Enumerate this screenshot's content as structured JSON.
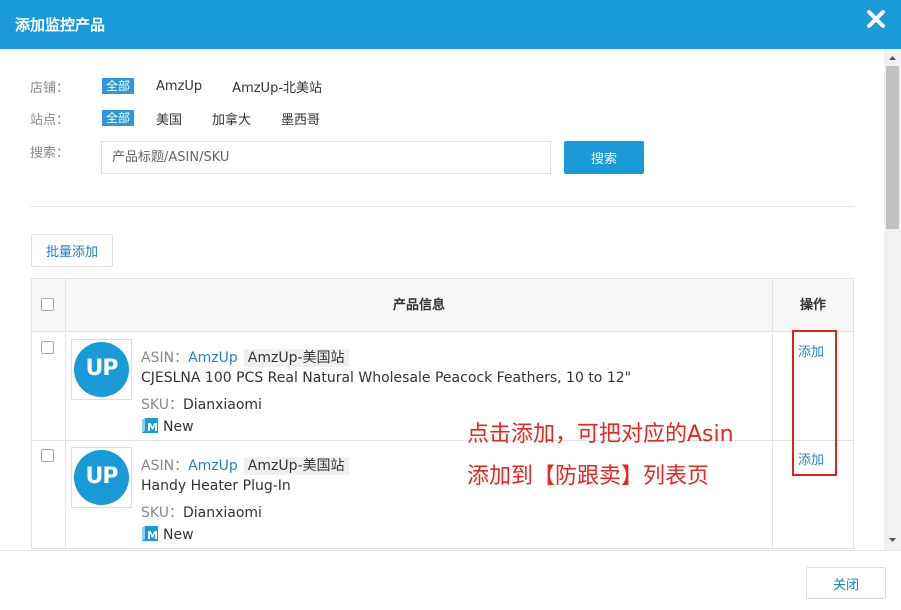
{
  "dialog": {
    "title": "添加监控产品",
    "close_icon": "close-x-icon"
  },
  "filters": {
    "store": {
      "label": "店铺：",
      "options": [
        "全部",
        "AmzUp",
        "AmzUp-北美站"
      ],
      "selected": "全部"
    },
    "site": {
      "label": "站点：",
      "options": [
        "全部",
        "美国",
        "加拿大",
        "墨西哥"
      ],
      "selected": "全部"
    },
    "search": {
      "label": "搜索：",
      "placeholder": "产品标题/ASIN/SKU",
      "button_label": "搜索"
    }
  },
  "batch_add_label": "批量添加",
  "table": {
    "headers": {
      "info": "产品信息",
      "action": "操作"
    },
    "rows": [
      {
        "logo_text": "UP",
        "asin_label": "ASIN：",
        "asin": "AmzUp",
        "store": "AmzUp-美国站",
        "title": "CJESLNA 100 PCS Real Natural Wholesale Peacock Feathers, 10 to 12\"",
        "sku_label": "SKU：",
        "sku": "Dianxiaomi",
        "condition_icon": "M",
        "condition": "New",
        "action_label": "添加"
      },
      {
        "logo_text": "UP",
        "asin_label": "ASIN：",
        "asin": "AmzUp",
        "store": "AmzUp-美国站",
        "title": "Handy Heater Plug-In",
        "sku_label": "SKU：",
        "sku": "Dianxiaomi",
        "condition_icon": "M",
        "condition": "New",
        "action_label": "添加"
      }
    ]
  },
  "annotation": {
    "line1": "点击添加，可把对应的Asin",
    "line2": "添加到【防跟卖】列表页",
    "color": "#e8261e"
  },
  "footer": {
    "close_label": "关闭"
  },
  "colors": {
    "primary": "#1a9ad6",
    "link": "#2a7fc4",
    "annotation_red": "#d9231c"
  }
}
